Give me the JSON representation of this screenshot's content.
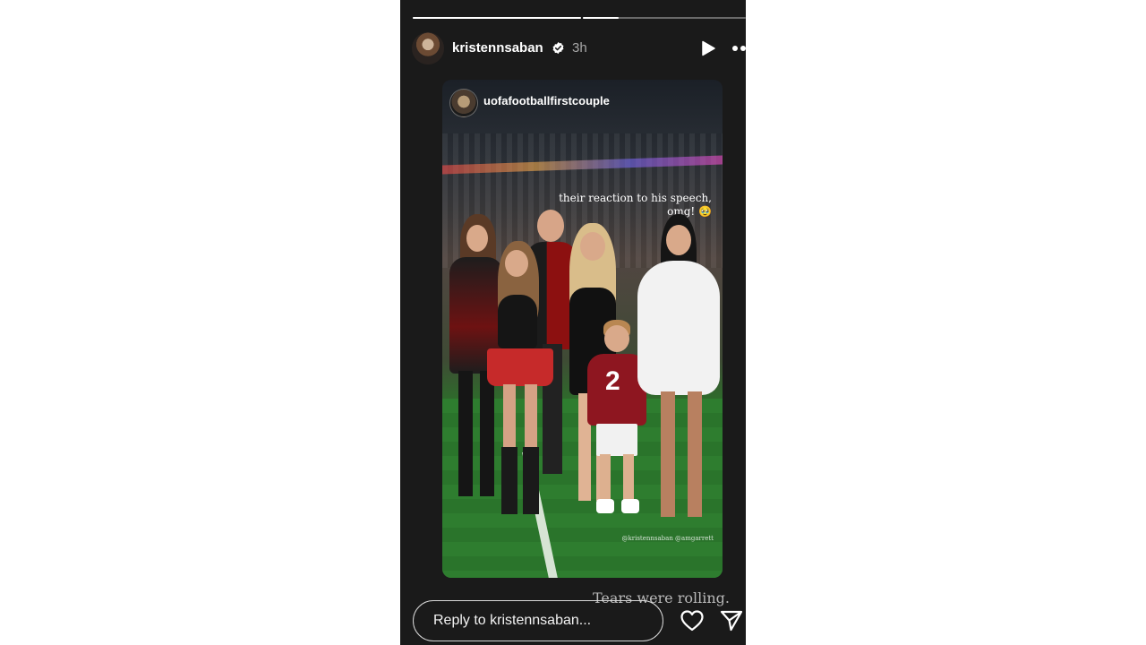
{
  "story": {
    "username": "kristennsaban",
    "time_ago": "3h",
    "progress": {
      "segments": 2,
      "current_segment_fill": 0.22
    },
    "icons": {
      "play": "play-icon",
      "more": "more-options-icon",
      "verified": "verified-badge-icon",
      "like": "heart-icon",
      "share": "send-icon"
    }
  },
  "shared_post": {
    "username": "uofafootballfirstcouple",
    "caption": "their reaction to his speech, omg! 🥹",
    "photo_tag": "@kristennsaban @amgarrett",
    "jersey_number": "2"
  },
  "overlay_text": "Tears were rolling.",
  "reply": {
    "placeholder": "Reply to kristennsaban..."
  },
  "colors": {
    "background": "#1a1a1a",
    "page": "#ffffff",
    "verified": "#ffffff"
  }
}
